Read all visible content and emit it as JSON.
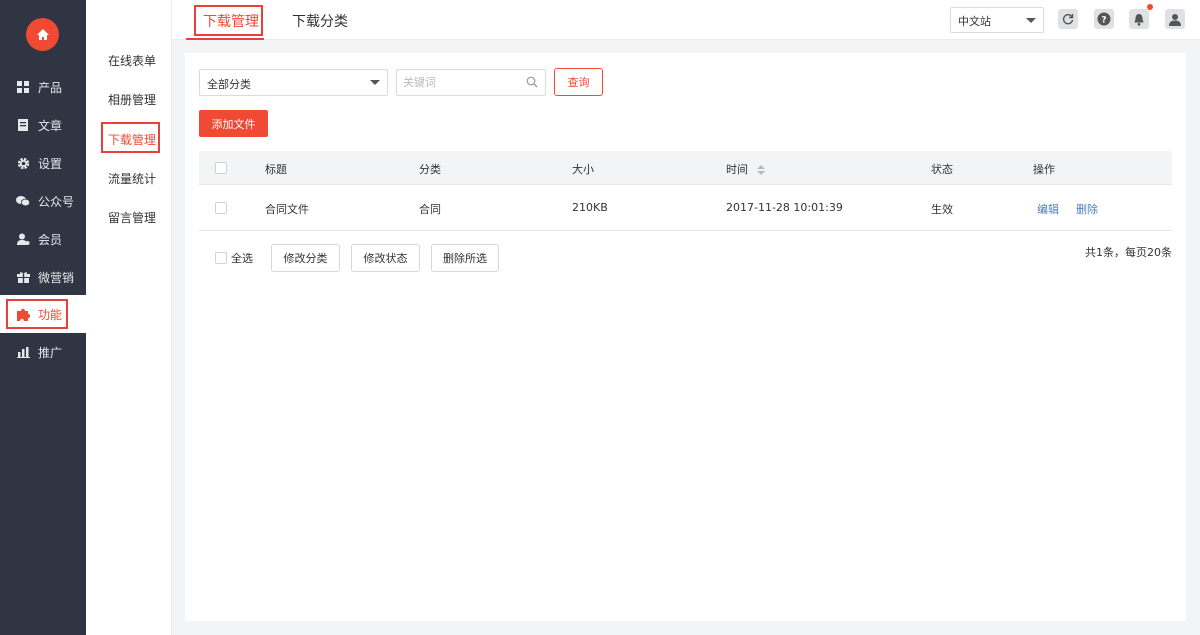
{
  "sidebar": {
    "items": [
      {
        "label": "产品",
        "icon": "grid-icon"
      },
      {
        "label": "文章",
        "icon": "document-icon"
      },
      {
        "label": "设置",
        "icon": "gear-icon"
      },
      {
        "label": "公众号",
        "icon": "wechat-icon"
      },
      {
        "label": "会员",
        "icon": "user-icon"
      },
      {
        "label": "微营销",
        "icon": "gift-icon"
      },
      {
        "label": "功能",
        "icon": "puzzle-icon"
      },
      {
        "label": "推广",
        "icon": "bar-chart-icon"
      }
    ],
    "active_index": 6
  },
  "subnav": {
    "items": [
      {
        "label": "在线表单"
      },
      {
        "label": "相册管理"
      },
      {
        "label": "下载管理"
      },
      {
        "label": "流量统计"
      },
      {
        "label": "留言管理"
      }
    ],
    "active_index": 2
  },
  "header": {
    "tabs": [
      {
        "label": "下载管理"
      },
      {
        "label": "下载分类"
      }
    ],
    "active_tab": 0,
    "language": "中文站",
    "notification_dot": true
  },
  "filters": {
    "category_value": "全部分类",
    "keyword_placeholder": "关键词",
    "query_label": "查询"
  },
  "add_button": "添加文件",
  "table": {
    "columns": [
      "标题",
      "分类",
      "大小",
      "时间",
      "状态",
      "操作"
    ],
    "rows": [
      {
        "title": "合同文件",
        "category": "合同",
        "size": "210KB",
        "time": "2017-11-28 10:01:39",
        "status": "生效",
        "edit": "编辑",
        "delete": "删除"
      }
    ]
  },
  "footer": {
    "select_all": "全选",
    "actions": [
      "修改分类",
      "修改状态",
      "删除所选"
    ],
    "pager_info": "共1条，每页20条"
  },
  "colors": {
    "accent": "#f04a34",
    "sidebar_bg": "#2f3542",
    "link": "#4a7ec2"
  }
}
